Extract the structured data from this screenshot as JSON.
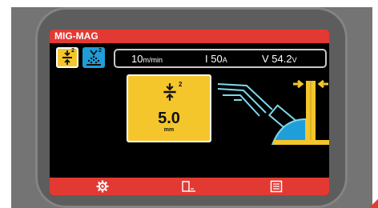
{
  "window": {
    "title": "MIG-MAG"
  },
  "mode_buttons": [
    {
      "icon": "wire-thickness-icon",
      "superscript": "2",
      "selected": true
    },
    {
      "icon": "spray-transfer-icon",
      "superscript": "2",
      "selected": false
    }
  ],
  "readout": {
    "wire_speed": "10",
    "wire_speed_unit": "m/min",
    "current_prefix": "I",
    "current": "50",
    "current_unit": "A",
    "voltage_prefix": "V",
    "voltage": "54.2",
    "voltage_unit": "V"
  },
  "parameter": {
    "icon": "wire-thickness-icon",
    "superscript": "2",
    "value": "5.0",
    "unit": "mm"
  },
  "bottom_bar": {
    "icons": [
      "gear-icon",
      "booklet-icon",
      "list-icon"
    ]
  },
  "colors": {
    "accent_red": "#e23a33",
    "highlight_yellow": "#f4c62c",
    "spray_blue": "#1f9ed9",
    "illustration_cyan": "#7fd8ee",
    "screen_bg": "#000000",
    "bezel": "#747474"
  }
}
